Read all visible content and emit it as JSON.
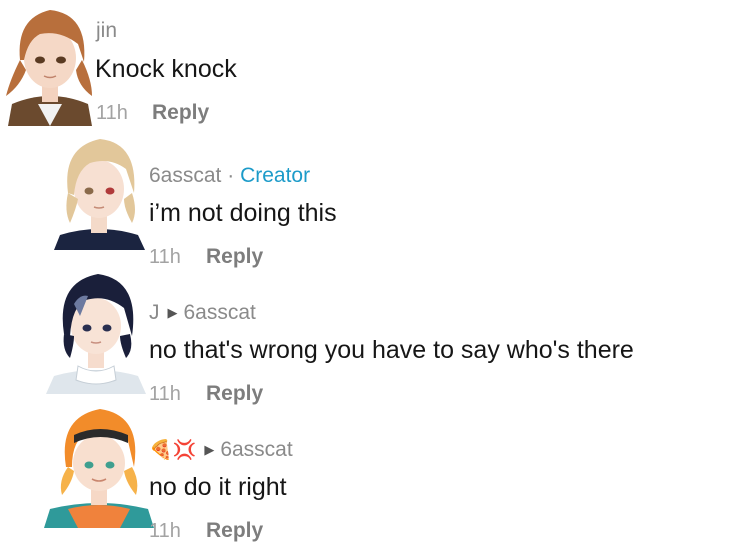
{
  "comments": [
    {
      "username": "jin",
      "text": "Knock knock",
      "time": "11h",
      "reply_label": "Reply"
    },
    {
      "username": "6asscat",
      "separator": "·",
      "badge": "Creator",
      "text": "i’m not doing this",
      "time": "11h",
      "reply_label": "Reply"
    },
    {
      "username": "J",
      "reply_to": "6asscat",
      "text": "no that's wrong you have to say who's there",
      "time": "11h",
      "reply_label": "Reply"
    },
    {
      "username_emoji": "🍕💢",
      "reply_to": "6asscat",
      "text": "no do it right",
      "time": "11h",
      "reply_label": "Reply"
    }
  ],
  "icons": {
    "reply_arrow": "play-right-icon"
  },
  "colors": {
    "text": "#161616",
    "username": "#8a8a8a",
    "meta": "#a3a3a3",
    "creator_badge": "#1c9bc9"
  }
}
